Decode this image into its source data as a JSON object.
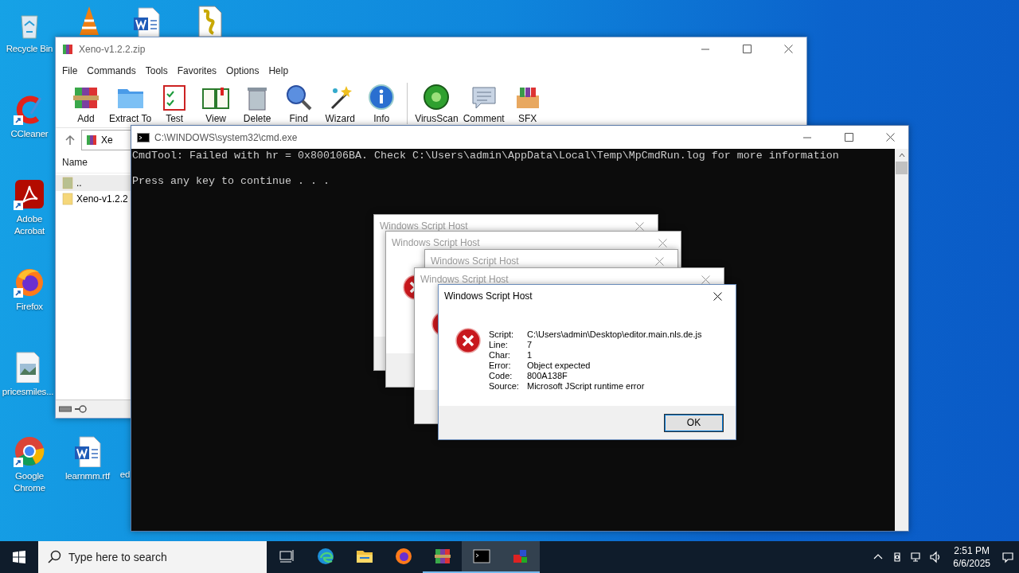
{
  "desktop_icons": [
    {
      "label": "Recycle Bin",
      "kind": "recycle"
    },
    {
      "kind": "cone"
    },
    {
      "kind": "word"
    },
    {
      "kind": "script"
    },
    {
      "label": "CCleaner",
      "kind": "ccleaner",
      "shortcut": true
    },
    {
      "label": "Adobe\nAcrobat",
      "kind": "acrobat",
      "shortcut": true
    },
    {
      "label": "Firefox",
      "kind": "firefox",
      "shortcut": true
    },
    {
      "label": "pricesmiles...",
      "kind": "image"
    },
    {
      "label": "Google\nChrome",
      "kind": "chrome",
      "shortcut": true
    },
    {
      "label": "learnmm.rtf",
      "kind": "word"
    },
    {
      "label": "ed"
    }
  ],
  "archiver": {
    "title": "Xeno-v1.2.2.zip",
    "menu": [
      "File",
      "Commands",
      "Tools",
      "Favorites",
      "Options",
      "Help"
    ],
    "toolbar_groups": [
      [
        {
          "label": "Add",
          "kind": "add"
        },
        {
          "label": "Extract To",
          "kind": "extract"
        },
        {
          "label": "Test",
          "kind": "test"
        },
        {
          "label": "View",
          "kind": "view"
        },
        {
          "label": "Delete",
          "kind": "delete"
        },
        {
          "label": "Find",
          "kind": "find"
        },
        {
          "label": "Wizard",
          "kind": "wizard"
        },
        {
          "label": "Info",
          "kind": "info"
        }
      ],
      [
        {
          "label": "VirusScan",
          "kind": "virus"
        },
        {
          "label": "Comment",
          "kind": "comment"
        },
        {
          "label": "SFX",
          "kind": "sfx"
        }
      ]
    ],
    "address": "Xe",
    "columns": [
      "Name"
    ],
    "files": [
      {
        "name": "..",
        "kind": "parent",
        "selected": true
      },
      {
        "name": "Xeno-v1.2.2",
        "kind": "folder",
        "selected": false
      }
    ]
  },
  "console": {
    "title": "C:\\WINDOWS\\system32\\cmd.exe",
    "lines": [
      "CmdTool: Failed with hr = 0x800106BA. Check C:\\Users\\admin\\AppData\\Local\\Temp\\MpCmdRun.log for more information",
      "Press any key to continue . . ."
    ]
  },
  "dialogs": [
    {
      "title": "Windows Script Host",
      "active": false,
      "kind": "plain"
    },
    {
      "title": "Windows Script Host",
      "active": false,
      "kind": "error"
    },
    {
      "title": "Windows Script Host",
      "active": false,
      "kind": "plain"
    },
    {
      "title": "Windows Script Host",
      "active": false,
      "kind": "error"
    },
    {
      "title": "Windows Script Host",
      "active": true,
      "kind": "error",
      "fields": [
        {
          "label": "Script:",
          "value": "C:\\Users\\admin\\Desktop\\editor.main.nls.de.js"
        },
        {
          "label": "Line:",
          "value": "7"
        },
        {
          "label": "Char:",
          "value": "1"
        },
        {
          "label": "Error:",
          "value": "Object expected"
        },
        {
          "label": "Code:",
          "value": "800A138F"
        },
        {
          "label": "Source:",
          "value": "Microsoft JScript runtime error"
        }
      ],
      "button": "OK"
    }
  ],
  "taskbar": {
    "search": {
      "placeholder": "Type here to search"
    },
    "apps": [
      {
        "kind": "edge",
        "open": false,
        "highlighted": false
      },
      {
        "kind": "explorer",
        "open": false,
        "highlighted": false
      },
      {
        "kind": "firefox",
        "open": false,
        "highlighted": false
      },
      {
        "kind": "archiver",
        "open": true,
        "highlighted": false
      },
      {
        "kind": "console",
        "open": true,
        "highlighted": true
      },
      {
        "kind": "script",
        "open": true,
        "highlighted": true
      }
    ],
    "time": "2:51 PM",
    "date": "6/6/2025"
  }
}
